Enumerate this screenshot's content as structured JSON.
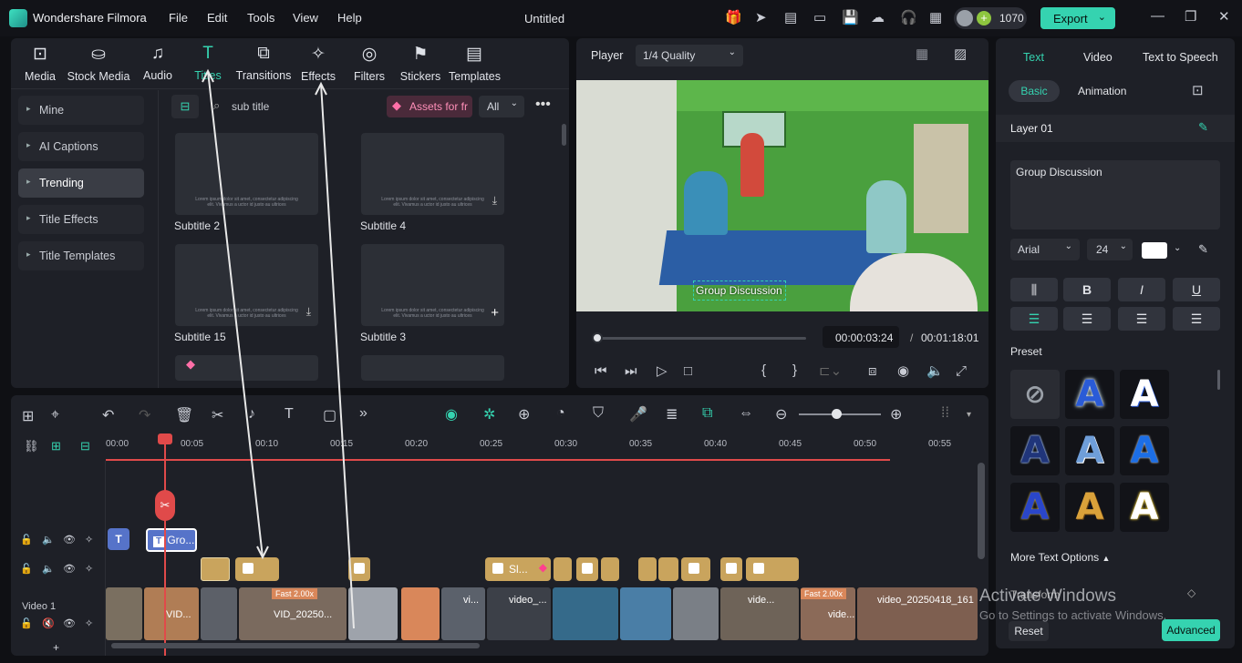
{
  "app": {
    "name": "Wondershare Filmora",
    "title": "Untitled",
    "credits": "1070",
    "export_label": "Export"
  },
  "menu": [
    "File",
    "Edit",
    "Tools",
    "View",
    "Help"
  ],
  "media_tabs": [
    {
      "label": "Media",
      "icon": "media-icon"
    },
    {
      "label": "Stock Media",
      "icon": "stock-media-icon"
    },
    {
      "label": "Audio",
      "icon": "audio-icon"
    },
    {
      "label": "Titles",
      "icon": "titles-icon"
    },
    {
      "label": "Transitions",
      "icon": "transitions-icon"
    },
    {
      "label": "Effects",
      "icon": "effects-icon"
    },
    {
      "label": "Filters",
      "icon": "filters-icon"
    },
    {
      "label": "Stickers",
      "icon": "stickers-icon"
    },
    {
      "label": "Templates",
      "icon": "templates-icon"
    }
  ],
  "sidebar": {
    "items": [
      "Mine",
      "AI Captions",
      "Trending",
      "Title Effects",
      "Title Templates"
    ]
  },
  "browser": {
    "search": "sub title",
    "assets_btn": "Assets for fr",
    "filter": "All",
    "items": [
      "Subtitle 2",
      "Subtitle 4",
      "Subtitle 15",
      "Subtitle 3"
    ],
    "lorem": "Lorem ipsum dolor sit amet, consectetur adipiscing elit. Vivamus a uctor id justo au ultrices"
  },
  "player": {
    "label": "Player",
    "quality": "1/4 Quality",
    "caption": "Group Discussion",
    "current_time": "00:00:03:24",
    "total_time": "00:01:18:01",
    "progress": 0.02
  },
  "timeline": {
    "ruler": [
      "00:00",
      "00:05",
      "00:10",
      "00:15",
      "00:20",
      "00:25",
      "00:30",
      "00:35",
      "00:40",
      "00:45",
      "00:50",
      "00:55"
    ],
    "title_clip": "Gro...",
    "sticker_clip": "Sl...",
    "track_label": "Video 1",
    "speed1": "Fast 2.00x",
    "speed2": "Fast 2.00x",
    "clip_names": [
      "VID...",
      "VID_20250...",
      "vi...",
      "video_...",
      "vide...",
      "video_20250418_161",
      "vide..."
    ]
  },
  "right_panel": {
    "tabs": [
      "Text",
      "Video",
      "Text to Speech"
    ],
    "subtabs": [
      "Basic",
      "Animation"
    ],
    "layer": "Layer 01",
    "text_value": "Group Discussion",
    "font": "Arial",
    "size": "24",
    "preset_label": "Preset",
    "more_options": "More Text Options",
    "transform": "Transform",
    "reset": "Reset",
    "advanced": "Advanced"
  },
  "watermark": {
    "line1": "Activate Windows",
    "line2": "Go to Settings to activate Windows."
  },
  "colors": {
    "accent": "#35d3b0",
    "gold": "#c9a45d",
    "playhead": "#e04a4a"
  }
}
